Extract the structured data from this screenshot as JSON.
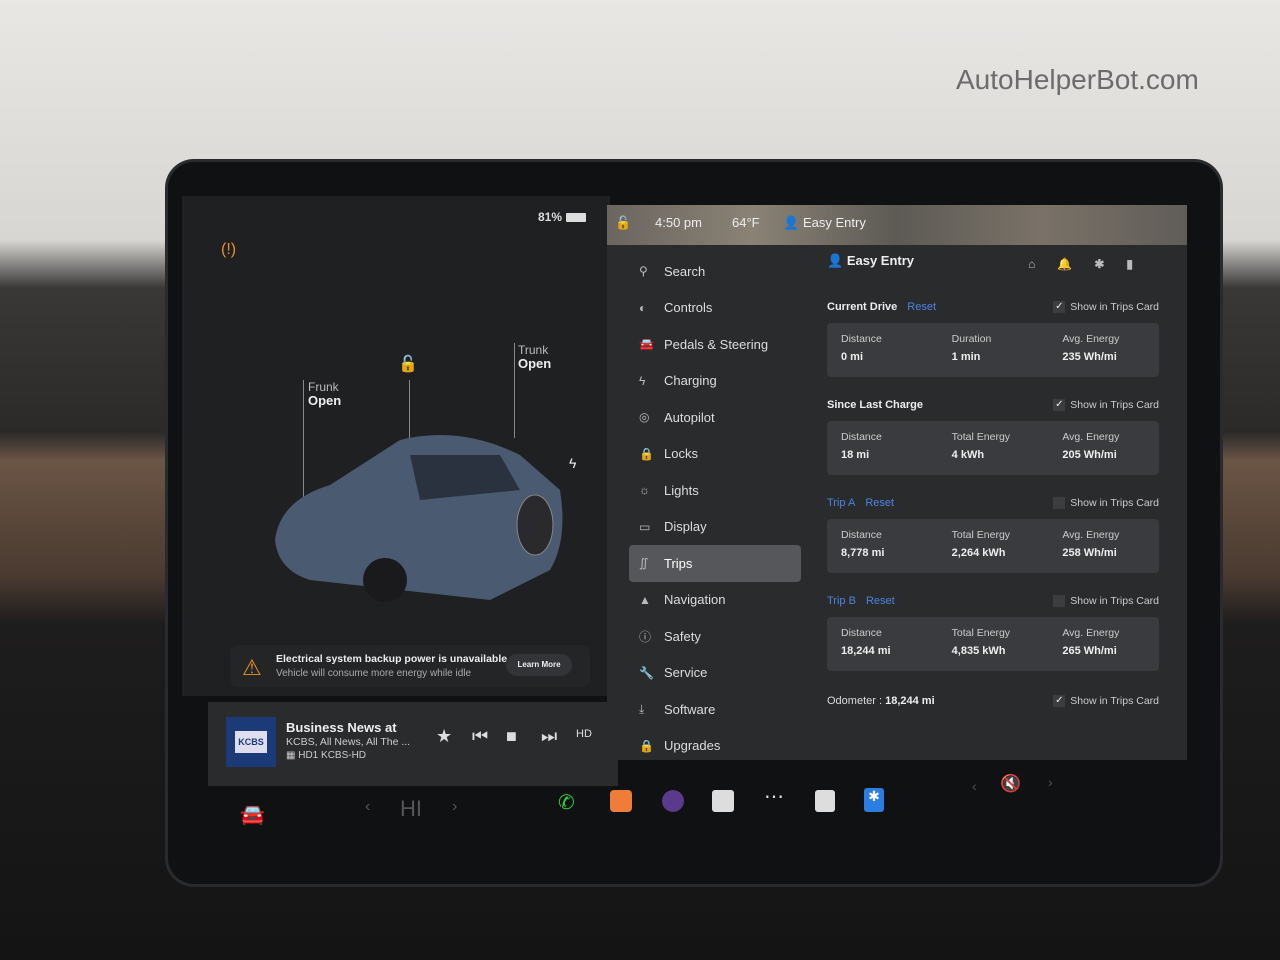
{
  "watermark": "AutoHelperBot.com",
  "status": {
    "battery": "81%",
    "time": "4:50 pm",
    "temperature": "64°F",
    "profile": "Easy Entry"
  },
  "vehicle": {
    "frunk_label": "Frunk",
    "frunk_state": "Open",
    "trunk_label": "Trunk",
    "trunk_state": "Open"
  },
  "alert": {
    "title": "Electrical system backup power is unavailable",
    "subtitle": "Vehicle will consume more energy while idle",
    "button": "Learn More"
  },
  "media": {
    "art_text": "KCBS",
    "title": "Business News at",
    "subtitle": "KCBS, All News, All The ...",
    "station": "HD1 KCBS-HD",
    "hd": "HD"
  },
  "nav": [
    {
      "label": "Search",
      "icon": "search-icon",
      "glyph": "⚲"
    },
    {
      "label": "Controls",
      "icon": "toggle-icon",
      "glyph": "◐"
    },
    {
      "label": "Pedals & Steering",
      "icon": "car-icon",
      "glyph": "🚘"
    },
    {
      "label": "Charging",
      "icon": "bolt-icon",
      "glyph": "ϟ"
    },
    {
      "label": "Autopilot",
      "icon": "steering-wheel-icon",
      "glyph": "◎"
    },
    {
      "label": "Locks",
      "icon": "lock-icon",
      "glyph": "🔒"
    },
    {
      "label": "Lights",
      "icon": "sun-icon",
      "glyph": "☼"
    },
    {
      "label": "Display",
      "icon": "display-icon",
      "glyph": "▭"
    },
    {
      "label": "Trips",
      "icon": "trips-icon",
      "glyph": "∬",
      "active": true
    },
    {
      "label": "Navigation",
      "icon": "navigation-icon",
      "glyph": "▲"
    },
    {
      "label": "Safety",
      "icon": "safety-icon",
      "glyph": "ⓘ"
    },
    {
      "label": "Service",
      "icon": "wrench-icon",
      "glyph": "🔧"
    },
    {
      "label": "Software",
      "icon": "download-icon",
      "glyph": "⤓"
    },
    {
      "label": "Upgrades",
      "icon": "bag-icon",
      "glyph": "🔒"
    }
  ],
  "trips": {
    "profile": "Easy Entry",
    "show_label": "Show in Trips Card",
    "reset_label": "Reset",
    "sections": [
      {
        "title": "Current Drive",
        "reset": true,
        "checked": true,
        "stats": [
          {
            "label": "Distance",
            "value": "0 mi"
          },
          {
            "label": "Duration",
            "value": "1 min"
          },
          {
            "label": "Avg. Energy",
            "value": "235 Wh/mi"
          }
        ]
      },
      {
        "title": "Since Last Charge",
        "reset": false,
        "checked": true,
        "stats": [
          {
            "label": "Distance",
            "value": "18 mi"
          },
          {
            "label": "Total Energy",
            "value": "4 kWh"
          },
          {
            "label": "Avg. Energy",
            "value": "205 Wh/mi"
          }
        ]
      },
      {
        "title": "Trip A",
        "reset": true,
        "checked": false,
        "blue": true,
        "stats": [
          {
            "label": "Distance",
            "value": "8,778 mi"
          },
          {
            "label": "Total Energy",
            "value": "2,264 kWh"
          },
          {
            "label": "Avg. Energy",
            "value": "258 Wh/mi"
          }
        ]
      },
      {
        "title": "Trip B",
        "reset": true,
        "checked": false,
        "blue": true,
        "stats": [
          {
            "label": "Distance",
            "value": "18,244 mi"
          },
          {
            "label": "Total Energy",
            "value": "4,835 kWh"
          },
          {
            "label": "Avg. Energy",
            "value": "265 Wh/mi"
          }
        ]
      }
    ],
    "odometer_label": "Odometer :",
    "odometer_value": "18,244 mi"
  },
  "dock": {
    "climate": "HI",
    "colors": {
      "phone": "#2ecc40",
      "media": "#f07c3a",
      "bluetooth": "#2a7de1"
    }
  }
}
